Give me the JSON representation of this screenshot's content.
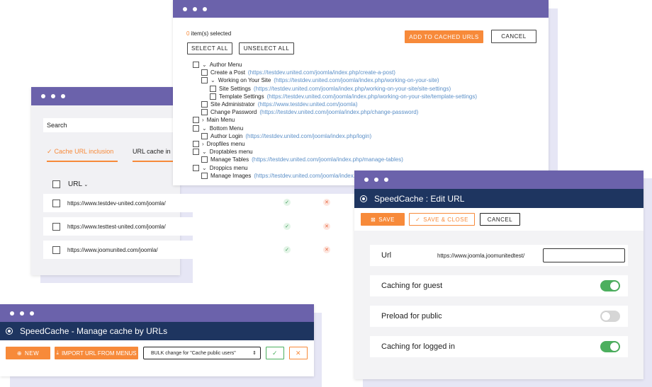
{
  "colors": {
    "titlebar": "#6b62ab",
    "navy": "#1e3560",
    "accent": "#f78a3a",
    "toggle_on": "#4caf5e",
    "toggle_off": "#d6d6d6",
    "link": "#5b8fc7"
  },
  "menu_window": {
    "selected_count": "0",
    "selected_text": " item(s) selected",
    "add_button": "ADD TO CACHED URLS",
    "cancel_button": "CANCEL",
    "select_all": "SELECT ALL",
    "unselect_all": "UNSELECT ALL",
    "tree": [
      {
        "label": "Author Menu",
        "url": "",
        "chevron": "⌄"
      },
      {
        "label": "Create a Post",
        "url": "(https://testdev.united.com/joomla/index.php/create-a-post)",
        "chevron": ""
      },
      {
        "label": "Working on Your Site",
        "url": "(https://testdev.united.com/joomla/index.php/working-on-your-site)",
        "chevron": "⌄"
      },
      {
        "label": "Site Settings",
        "url": "(https://testdev.united.com/joomla/index.php/working-on-your-site/site-settings)",
        "chevron": ""
      },
      {
        "label": "Template Settings",
        "url": "(https://testdev.united.com/joomla/index.php/working-on-your-site/template-settings)",
        "chevron": ""
      },
      {
        "label": "Site Administrator",
        "url": "(https://www.testdev.united.com/joomla)",
        "chevron": ""
      },
      {
        "label": "Change Password",
        "url": "(https://testdev.united.com/joomla/index.php/change-password)",
        "chevron": ""
      },
      {
        "label": "Main Menu",
        "url": "",
        "chevron": "›"
      },
      {
        "label": "Bottom Menu",
        "url": "",
        "chevron": "⌄"
      },
      {
        "label": "Author Login",
        "url": "(https://testdev.united.com/joomla/index.php/login)",
        "chevron": ""
      },
      {
        "label": "Dropfiles menu",
        "url": "",
        "chevron": "›"
      },
      {
        "label": "Droptables menu",
        "url": "",
        "chevron": "⌄"
      },
      {
        "label": "Manage Tables",
        "url": "(https://testdev.united.com/joomla/index.php/manage-tables)",
        "chevron": ""
      },
      {
        "label": "Droppics menu",
        "url": "",
        "chevron": "⌄"
      },
      {
        "label": "Manage Images",
        "url": "(https://testdev.united.com/joomla/index.php/mana",
        "chevron": ""
      }
    ]
  },
  "inclusion_window": {
    "search_label": "Search",
    "tab_active": "Cache URL inclusion",
    "tab_other": "URL cache in",
    "column_url": "URL",
    "rows": [
      {
        "url": "https://www.testdev-united.com/joomla/"
      },
      {
        "url": "https://www.testtest-united.com/joomla/"
      },
      {
        "url": "https://www.joomunited.com/joomla/"
      }
    ]
  },
  "manage_window": {
    "title": "SpeedCache - Manage cache by URLs",
    "new_button": "NEW",
    "import_button": "IMPORT URL FROM MENUS",
    "bulk_select": "BULK change for \"Cache public users\""
  },
  "edit_window": {
    "title": "SpeedCache : Edit URL",
    "save_button": "SAVE",
    "save_close_button": "SAVE & CLOSE",
    "cancel_button": "CANCEL",
    "url_label": "Url",
    "url_prefix": "https://www.joomla.joomunitedtest/",
    "url_value": "",
    "settings": [
      {
        "label": "Caching for guest",
        "enabled": true
      },
      {
        "label": "Preload for public",
        "enabled": false
      },
      {
        "label": "Caching for logged in",
        "enabled": true
      }
    ]
  }
}
